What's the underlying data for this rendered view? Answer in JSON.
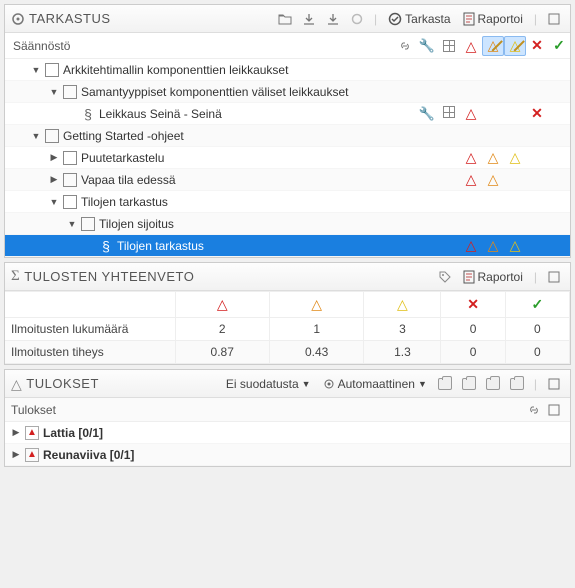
{
  "tarkastus": {
    "title": "TARKASTUS",
    "tarkasta_label": "Tarkasta",
    "raportoi_label": "Raportoi",
    "name_col": "Säännöstö",
    "rows": [
      {
        "label": "Arkkitehtimallin komponenttien leikkaukset",
        "indent": 1,
        "expander": "▼",
        "icon": "doc"
      },
      {
        "label": "Samantyyppiset komponenttien väliset leikkaukset",
        "indent": 2,
        "expander": "▼",
        "icon": "doc"
      },
      {
        "label": "Leikkaus Seinä - Seinä",
        "indent": 3,
        "expander": "",
        "icon": "sect",
        "tools": true,
        "tri_r": true,
        "x_red": true
      },
      {
        "label": "Getting Started -ohjeet",
        "indent": 1,
        "expander": "▼",
        "icon": "doc"
      },
      {
        "label": "Puutetarkastelu",
        "indent": 2,
        "expander": "▶",
        "icon": "doc",
        "tri_r": true,
        "tri_o": true,
        "tri_y": true
      },
      {
        "label": "Vapaa tila edessä",
        "indent": 2,
        "expander": "▶",
        "icon": "doc",
        "tri_r": true,
        "tri_o": true
      },
      {
        "label": "Tilojen tarkastus",
        "indent": 2,
        "expander": "▼",
        "icon": "doc"
      },
      {
        "label": "Tilojen sijoitus",
        "indent": 3,
        "expander": "▼",
        "icon": "doc"
      },
      {
        "label": "Tilojen tarkastus",
        "indent": 4,
        "expander": "",
        "icon": "sect",
        "selected": true,
        "tri_r": true,
        "tri_o": true,
        "tri_y": true
      }
    ]
  },
  "yhteenveto": {
    "title": "TULOSTEN YHTEENVETO",
    "raportoi_label": "Raportoi",
    "row1_label": "Ilmoitusten lukumäärä",
    "row2_label": "Ilmoitusten tiheys",
    "r": {
      "count": "2",
      "dens": "0.87"
    },
    "o": {
      "count": "1",
      "dens": "0.43"
    },
    "y": {
      "count": "3",
      "dens": "1.3"
    },
    "x": {
      "count": "0",
      "dens": "0"
    },
    "ok": {
      "count": "0",
      "dens": "0"
    }
  },
  "tulokset": {
    "title": "TULOKSET",
    "filter_label": "Ei suodatusta",
    "auto_label": "Automaattinen",
    "col_label": "Tulokset",
    "rows": [
      {
        "label": "Lattia [0/1]"
      },
      {
        "label": "Reunaviiva [0/1]"
      }
    ]
  }
}
